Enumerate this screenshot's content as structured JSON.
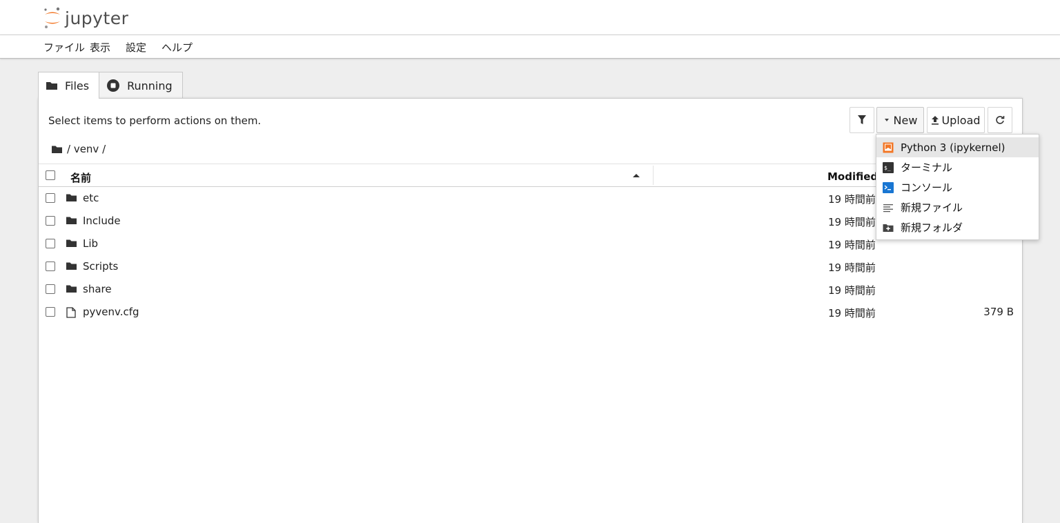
{
  "header": {
    "logo_text": "jupyter",
    "logo_icon": "jupyter-logo"
  },
  "menu": {
    "items": [
      {
        "label": "ファイル"
      },
      {
        "label": "表示"
      },
      {
        "label": "設定"
      },
      {
        "label": "ヘルプ"
      }
    ]
  },
  "tabs": [
    {
      "label": "Files",
      "icon": "folder-icon",
      "active": true
    },
    {
      "label": "Running",
      "icon": "stop-circle-icon",
      "active": false
    }
  ],
  "toolbar": {
    "hint": "Select items to perform actions on them.",
    "filter_icon": "filter-icon",
    "new_label": "New",
    "upload_label": "Upload",
    "refresh_icon": "refresh-icon"
  },
  "breadcrumb": {
    "path": "/ venv /"
  },
  "table": {
    "col_name": "名前",
    "col_modified": "Modified",
    "rows": [
      {
        "name": "etc",
        "type": "folder",
        "modified": "19 時間前",
        "size": ""
      },
      {
        "name": "Include",
        "type": "folder",
        "modified": "19 時間前",
        "size": ""
      },
      {
        "name": "Lib",
        "type": "folder",
        "modified": "19 時間前",
        "size": ""
      },
      {
        "name": "Scripts",
        "type": "folder",
        "modified": "19 時間前",
        "size": ""
      },
      {
        "name": "share",
        "type": "folder",
        "modified": "19 時間前",
        "size": ""
      },
      {
        "name": "pyvenv.cfg",
        "type": "file",
        "modified": "19 時間前",
        "size": "379 B"
      }
    ]
  },
  "new_menu": {
    "items": [
      {
        "label": "Python 3 (ipykernel)",
        "icon": "notebook-icon"
      },
      {
        "label": "ターミナル",
        "icon": "terminal-icon"
      },
      {
        "label": "コンソール",
        "icon": "console-icon"
      },
      {
        "label": "新規ファイル",
        "icon": "text-file-icon"
      },
      {
        "label": "新規フォルダ",
        "icon": "new-folder-icon"
      }
    ]
  },
  "colors": {
    "jupyter_orange": "#F37726",
    "console_blue": "#1976D2",
    "terminal_black": "#333333"
  }
}
